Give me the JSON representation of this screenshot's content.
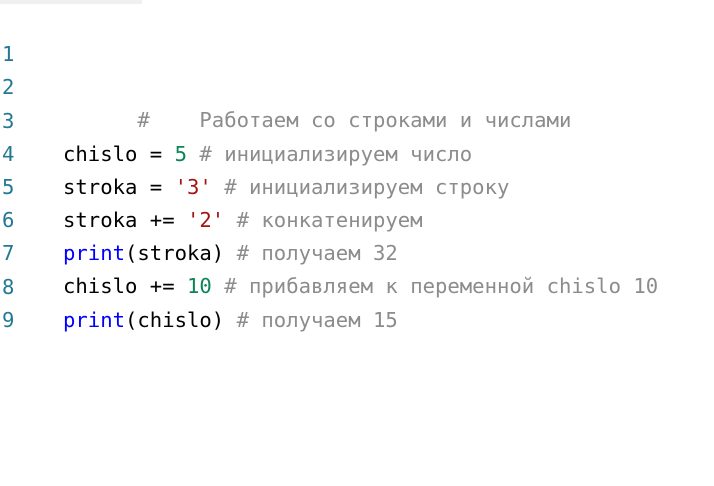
{
  "lines": [
    {
      "number": "1",
      "tokens": [
        {
          "type": "comment",
          "text": "#    Работаем со строками и числами"
        }
      ]
    },
    {
      "number": "2",
      "tokens": []
    },
    {
      "number": "3",
      "tokens": [
        {
          "type": "plain",
          "text": "chislo = "
        },
        {
          "type": "number",
          "text": "5"
        },
        {
          "type": "comment",
          "text": " # инициализируем число"
        }
      ]
    },
    {
      "number": "4",
      "tokens": [
        {
          "type": "plain",
          "text": "stroka = "
        },
        {
          "type": "string",
          "text": "'3'"
        },
        {
          "type": "comment",
          "text": " # инициализируем строку"
        }
      ]
    },
    {
      "number": "5",
      "tokens": [
        {
          "type": "plain",
          "text": "stroka += "
        },
        {
          "type": "string",
          "text": "'2'"
        },
        {
          "type": "comment",
          "text": " # конкатенируем"
        }
      ]
    },
    {
      "number": "6",
      "tokens": [
        {
          "type": "builtin",
          "text": "print"
        },
        {
          "type": "plain",
          "text": "(stroka)"
        },
        {
          "type": "comment",
          "text": " # получаем 32"
        }
      ]
    },
    {
      "number": "7",
      "tokens": [
        {
          "type": "plain",
          "text": "chislo += "
        },
        {
          "type": "number",
          "text": "10"
        },
        {
          "type": "comment",
          "text": " # прибавляем к переменной chislo 10"
        }
      ]
    },
    {
      "number": "8",
      "tokens": [
        {
          "type": "builtin",
          "text": "print"
        },
        {
          "type": "plain",
          "text": "(chislo)"
        },
        {
          "type": "comment",
          "text": " # получаем 15"
        }
      ]
    },
    {
      "number": "9",
      "tokens": []
    }
  ],
  "colors": {
    "line_number": "#237893",
    "comment": "#8c8c8c",
    "number": "#098658",
    "string": "#a31515",
    "builtin": "#0000ff",
    "plain": "#000000"
  }
}
